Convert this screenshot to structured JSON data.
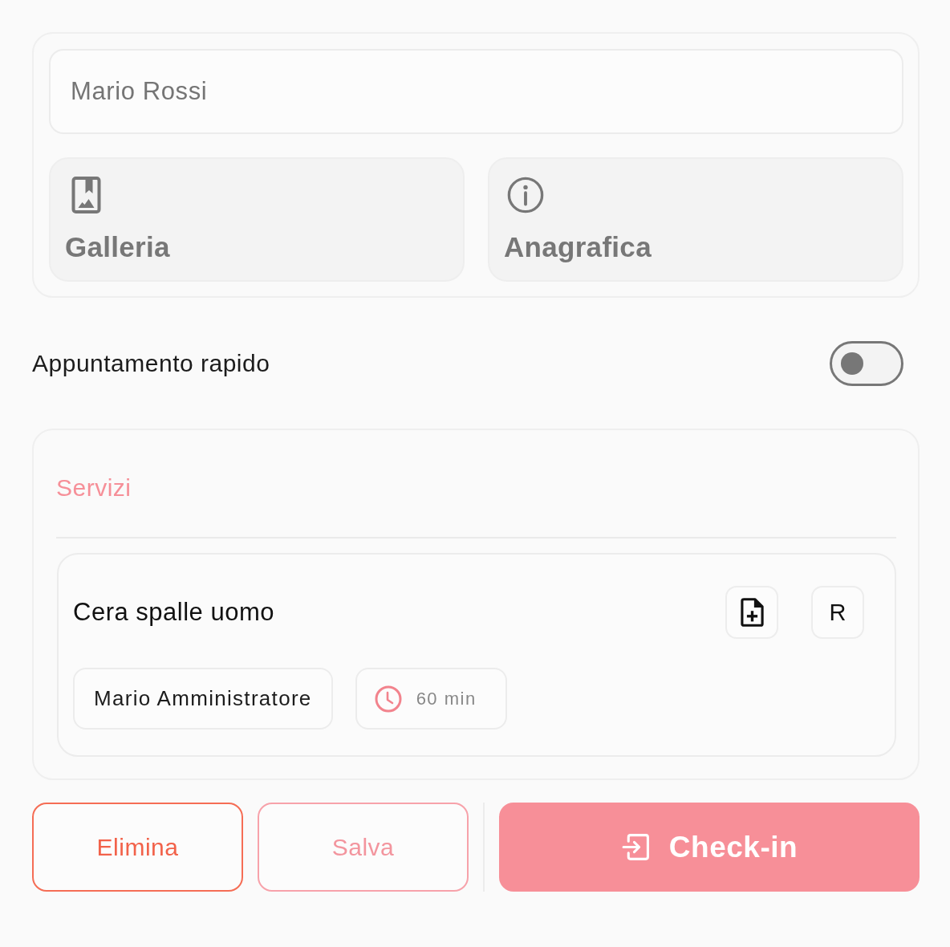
{
  "name_field": {
    "value": "Mario Rossi"
  },
  "tiles": [
    {
      "kind": "gallery",
      "label": "Galleria"
    },
    {
      "kind": "info",
      "label": "Anagrafica"
    }
  ],
  "quick_appointment": {
    "label": "Appuntamento rapido",
    "on": false
  },
  "services": {
    "title": "Servizi",
    "items": [
      {
        "name": "Cera spalle uomo",
        "actions": [
          {
            "kind": "add-document"
          },
          {
            "kind": "letter",
            "label": "R"
          }
        ],
        "operator": "Mario Amministratore",
        "duration": "60 min"
      }
    ]
  },
  "actions": [
    {
      "kind": "danger",
      "label": "Elimina"
    },
    {
      "kind": "secondary",
      "label": "Salva"
    },
    {
      "kind": "primary",
      "label": "Check-in"
    }
  ]
}
